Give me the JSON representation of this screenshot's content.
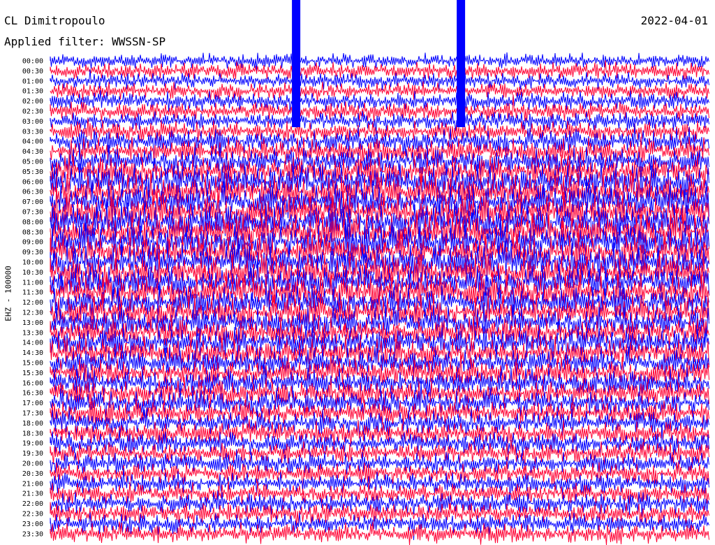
{
  "header": {
    "station": "CL Dimitropoulo",
    "date": "2022-04-01",
    "filter": "Applied filter: WWSSN-SP"
  },
  "chart_data": {
    "type": "line",
    "title": "CL Dimitropoulo",
    "subtitle": "Applied filter: WWSSN-SP",
    "ylabel": "EHZ - 100000",
    "xlabel": "",
    "tick_labels": [
      "00:00",
      "00:30",
      "01:00",
      "01:30",
      "02:00",
      "02:30",
      "03:00",
      "03:30",
      "04:00",
      "04:30",
      "05:00",
      "05:30",
      "06:00",
      "06:30",
      "07:00",
      "07:30",
      "08:00",
      "08:30",
      "09:00",
      "09:30",
      "10:00",
      "10:30",
      "11:00",
      "11:30",
      "12:00",
      "12:30",
      "13:00",
      "13:30",
      "14:00",
      "14:30",
      "15:00",
      "15:30",
      "16:00",
      "16:30",
      "17:00",
      "17:30",
      "18:00",
      "18:30",
      "19:00",
      "19:30",
      "20:00",
      "20:30",
      "21:00",
      "21:30",
      "22:00",
      "22:30",
      "23:00",
      "23:30"
    ],
    "trace_colors": [
      "#0000ff",
      "#ff0033"
    ],
    "activity_level_by_row": [
      0.25,
      0.3,
      0.28,
      0.3,
      0.35,
      0.38,
      0.35,
      0.42,
      0.55,
      0.62,
      0.7,
      0.75,
      0.85,
      0.9,
      0.92,
      0.95,
      0.95,
      0.95,
      0.95,
      0.93,
      0.92,
      0.9,
      0.88,
      0.85,
      0.82,
      0.8,
      0.78,
      0.75,
      0.72,
      0.7,
      0.68,
      0.66,
      0.65,
      0.63,
      0.6,
      0.58,
      0.55,
      0.52,
      0.5,
      0.48,
      0.45,
      0.45,
      0.44,
      0.45,
      0.48,
      0.44,
      0.42,
      0.45
    ],
    "events": [
      {
        "time_row": 0,
        "position_fraction": 0.373,
        "note": "large spike"
      },
      {
        "time_row": 0,
        "position_fraction": 0.623,
        "note": "large spike"
      }
    ],
    "grid": false
  }
}
